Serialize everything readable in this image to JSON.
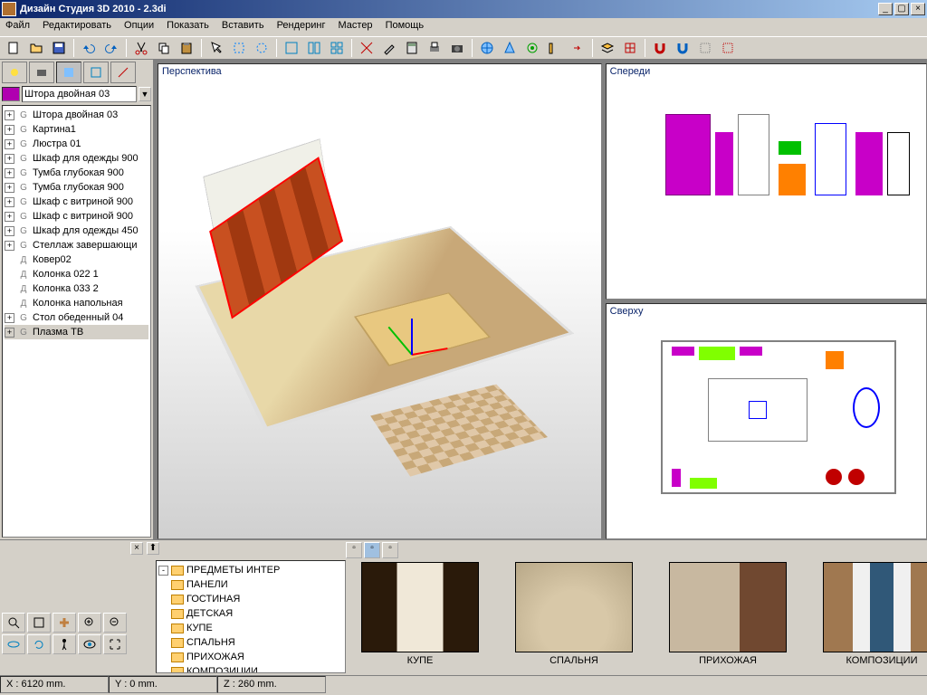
{
  "window": {
    "title": "Дизайн Студия 3D 2010 - 2.3di"
  },
  "menu": {
    "file": "Файл",
    "edit": "Редактировать",
    "options": "Опции",
    "show": "Показать",
    "insert": "Вставить",
    "render": "Рендеринг",
    "master": "Мастер",
    "help": "Помощь"
  },
  "selector": {
    "label": "Штора двойная 03"
  },
  "scene_tree": [
    {
      "exp": "+",
      "icon": "G",
      "label": "Штора двойная 03"
    },
    {
      "exp": "+",
      "icon": "G",
      "label": "Картина1"
    },
    {
      "exp": "+",
      "icon": "G",
      "label": "Люстра 01"
    },
    {
      "exp": "+",
      "icon": "G",
      "label": "Шкаф для одежды 900"
    },
    {
      "exp": "+",
      "icon": "G",
      "label": "Тумба глубокая 900"
    },
    {
      "exp": "+",
      "icon": "G",
      "label": "Тумба глубокая 900"
    },
    {
      "exp": "+",
      "icon": "G",
      "label": "Шкаф с витриной 900"
    },
    {
      "exp": "+",
      "icon": "G",
      "label": "Шкаф с витриной 900"
    },
    {
      "exp": "+",
      "icon": "G",
      "label": "Шкаф для одежды 450"
    },
    {
      "exp": "+",
      "icon": "G",
      "label": "Стеллаж завершающи"
    },
    {
      "exp": "",
      "icon": "Д",
      "label": "Ковер02"
    },
    {
      "exp": "",
      "icon": "Д",
      "label": "Колонка 022 1"
    },
    {
      "exp": "",
      "icon": "Д",
      "label": "Колонка 033 2"
    },
    {
      "exp": "",
      "icon": "Д",
      "label": "Колонка напольная"
    },
    {
      "exp": "+",
      "icon": "G",
      "label": "Стол обеденный 04"
    },
    {
      "exp": "+",
      "icon": "G",
      "label": "Плазма ТВ",
      "sel": true
    }
  ],
  "viewports": {
    "perspective": "Перспектива",
    "front": "Спереди",
    "top": "Сверху"
  },
  "catalog_tree": [
    "ПРЕДМЕТЫ ИНТЕР",
    "ПАНЕЛИ",
    "ГОСТИНАЯ",
    "ДЕТСКАЯ",
    "КУПЕ",
    "СПАЛЬНЯ",
    "ПРИХОЖАЯ",
    "КОМПОЗИЦИИ"
  ],
  "thumbs": [
    {
      "label": "КУПЕ",
      "cls": "kupe"
    },
    {
      "label": "СПАЛЬНЯ",
      "cls": "spal"
    },
    {
      "label": "ПРИХОЖАЯ",
      "cls": "prih"
    },
    {
      "label": "КОМПОЗИЦИИ",
      "cls": "komp"
    }
  ],
  "status": {
    "x": "X : 6120 mm.",
    "y": "Y : 0 mm.",
    "z": "Z : 260 mm."
  }
}
